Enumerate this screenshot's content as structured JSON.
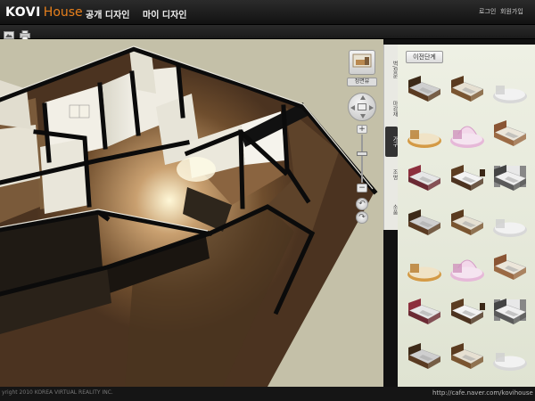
{
  "header": {
    "logo_primary": "KOVI",
    "logo_secondary": "House",
    "nav": [
      "공개 디자인",
      "마이 디자인"
    ],
    "links": [
      "로그인",
      "회원가입"
    ]
  },
  "toolbar": {
    "buttons": [
      {
        "icon": "image-icon"
      },
      {
        "icon": "print-icon"
      }
    ]
  },
  "viewport_controls": {
    "view_label": "정면뷰",
    "zoom_plus": "+",
    "zoom_minus": "−",
    "rotate_left": "↶",
    "rotate_right": "↷"
  },
  "side_tabs": [
    {
      "label": "벽/창문",
      "active": false
    },
    {
      "label": "마감재",
      "active": false
    },
    {
      "label": "가구",
      "active": true
    },
    {
      "label": "조명",
      "active": false
    },
    {
      "label": "소품",
      "active": false
    }
  ],
  "catalog": {
    "prev_label": "이전단계",
    "items": [
      "bed-dark-icon",
      "bed-brown-icon",
      "bed-round-icon",
      "bed-wood-round-icon",
      "bed-pink-canopy-icon",
      "bed-platform-icon",
      "bed-red-headboard-icon",
      "bed-nightstand-icon",
      "bed-curtain-icon",
      "bed-dark-icon",
      "bed-brown-icon",
      "bed-round-icon",
      "bed-wood-round-icon",
      "bed-pink-canopy-icon",
      "bed-platform-icon",
      "bed-red-headboard-icon",
      "bed-nightstand-icon",
      "bed-curtain-icon",
      "bed-dark-icon",
      "bed-brown-icon",
      "bed-round-icon",
      "bed-red-headboard-icon",
      "bed-nightstand-icon",
      "bed-curtain-icon"
    ]
  },
  "colors": {
    "accent": "#e8801c",
    "floor": "#6b4a2c",
    "wall": "#ece9dc",
    "panel": "#e6e8dc"
  },
  "footer": {
    "copyright": "yright 2010 KOREA VIRTUAL REALITY INC.",
    "url": "http://cafe.naver.com/kovihouse"
  }
}
